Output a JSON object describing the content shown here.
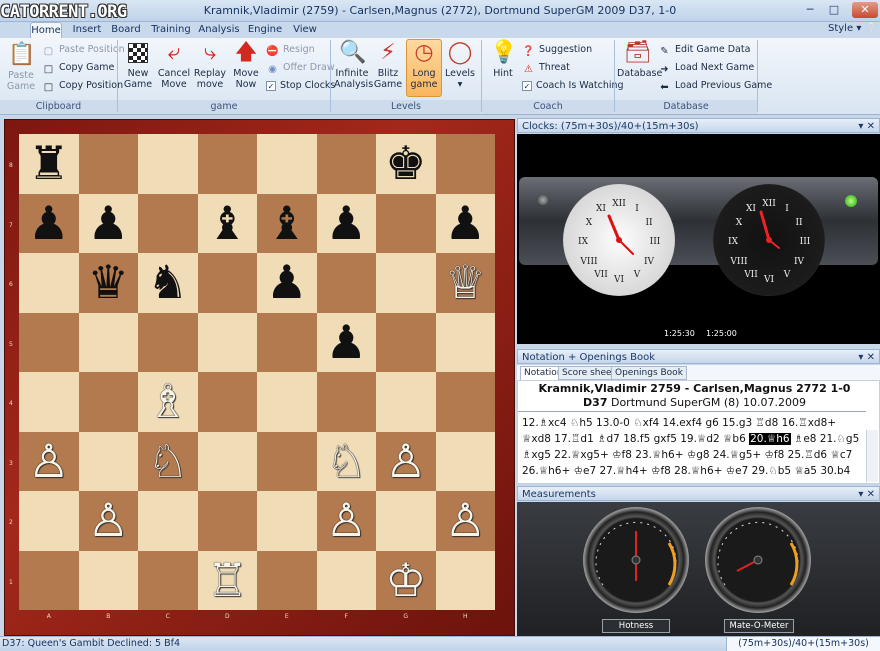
{
  "window": {
    "logo": "CATORRENT.ORG",
    "title": "Kramnik,Vladimir (2759) - Carlsen,Magnus (2772), Dortmund SuperGM 2009  D37, 1-0"
  },
  "tabs": [
    "Home",
    "Insert",
    "Board",
    "Training",
    "Analysis",
    "Engine",
    "View"
  ],
  "style_label": "Style",
  "ribbon": {
    "clipboard": {
      "paste_game": "Paste Game",
      "paste_position": "Paste Position",
      "copy_game": "Copy Game",
      "copy_position": "Copy Position",
      "label": "Clipboard"
    },
    "game": {
      "new_game": "New Game",
      "cancel_move": "Cancel Move",
      "replay_move": "Replay move",
      "move_now": "Move Now",
      "resign": "Resign",
      "offer_draw": "Offer Draw",
      "stop_clocks": "Stop Clocks",
      "label": "game"
    },
    "levels": {
      "infinite_analysis": "Infinite Analysis",
      "blitz_game": "Blitz Game",
      "long_game": "Long game",
      "levels": "Levels",
      "label": "Levels"
    },
    "coach": {
      "hint": "Hint",
      "suggestion": "Suggestion",
      "threat": "Threat",
      "coach_watching": "Coach Is Watching",
      "label": "Coach"
    },
    "database": {
      "database": "Database",
      "edit_game_data": "Edit Game Data",
      "load_next_game": "Load Next Game",
      "load_previous_game": "Load Previous Game",
      "label": "Database"
    }
  },
  "board": {
    "ranks": [
      "8",
      "7",
      "6",
      "5",
      "4",
      "3",
      "2",
      "1"
    ],
    "files": [
      "A",
      "B",
      "C",
      "D",
      "E",
      "F",
      "G",
      "H"
    ],
    "pieces": [
      {
        "sq": "a8",
        "g": "♜",
        "c": "b"
      },
      {
        "sq": "g8",
        "g": "♚",
        "c": "b"
      },
      {
        "sq": "a7",
        "g": "♟",
        "c": "b"
      },
      {
        "sq": "b7",
        "g": "♟",
        "c": "b"
      },
      {
        "sq": "d7",
        "g": "♝",
        "c": "b"
      },
      {
        "sq": "e7",
        "g": "♝",
        "c": "b"
      },
      {
        "sq": "f7",
        "g": "♟",
        "c": "b"
      },
      {
        "sq": "h7",
        "g": "♟",
        "c": "b"
      },
      {
        "sq": "b6",
        "g": "♛",
        "c": "b"
      },
      {
        "sq": "c6",
        "g": "♞",
        "c": "b"
      },
      {
        "sq": "e6",
        "g": "♟",
        "c": "b"
      },
      {
        "sq": "h6",
        "g": "♕",
        "c": "w"
      },
      {
        "sq": "f5",
        "g": "♟",
        "c": "b"
      },
      {
        "sq": "c4",
        "g": "♗",
        "c": "w"
      },
      {
        "sq": "a3",
        "g": "♙",
        "c": "w"
      },
      {
        "sq": "c3",
        "g": "♘",
        "c": "w"
      },
      {
        "sq": "f3",
        "g": "♘",
        "c": "w"
      },
      {
        "sq": "g3",
        "g": "♙",
        "c": "w"
      },
      {
        "sq": "b2",
        "g": "♙",
        "c": "w"
      },
      {
        "sq": "f2",
        "g": "♙",
        "c": "w"
      },
      {
        "sq": "h2",
        "g": "♙",
        "c": "w"
      },
      {
        "sq": "d1",
        "g": "♖",
        "c": "w"
      },
      {
        "sq": "g1",
        "g": "♔",
        "c": "w"
      }
    ]
  },
  "clocks": {
    "title": "Clocks: (75m+30s)/40+(15m+30s)",
    "white_time": "1:25:30",
    "black_time": "1:25:00"
  },
  "notation": {
    "title": "Notation + Openings Book",
    "tabs": [
      "Notation",
      "Score sheet",
      "Openings Book"
    ],
    "header_players": "Kramnik,Vladimir 2759 - Carlsen,Magnus 2772  1-0",
    "header_opening": "D37",
    "header_event": "Dortmund SuperGM (8) 10.07.2009",
    "line1": "12.♗xc4  ♘h5  13.0-0  ♘xf4  14.exf4  g6  15.g3  ♖d8  16.♖xd8+",
    "line2_pre": "♕xd8  17.♖d1  ♗d7  18.f5  gxf5  19.♕d2  ♕b6 ",
    "line2_hl": "20.♕h6",
    "line2_post": " ♗e8  21.♘g5",
    "line3": "♗xg5  22.♕xg5+  ♔f8  23.♕h6+  ♔g8  24.♕g5+  ♔f8  25.♖d6  ♕c7",
    "line4": "26.♕h6+  ♔e7  27.♕h4+  ♔f8  28.♕h6+  ♔e7  29.♘b5  ♕a5  30.b4"
  },
  "measurements": {
    "title": "Measurements",
    "gauge1": "Hotness",
    "gauge2": "Mate-O-Meter"
  },
  "status": {
    "left": "D37: Queen's Gambit Declined: 5 Bf4",
    "right": "(75m+30s)/40+(15m+30s)"
  }
}
